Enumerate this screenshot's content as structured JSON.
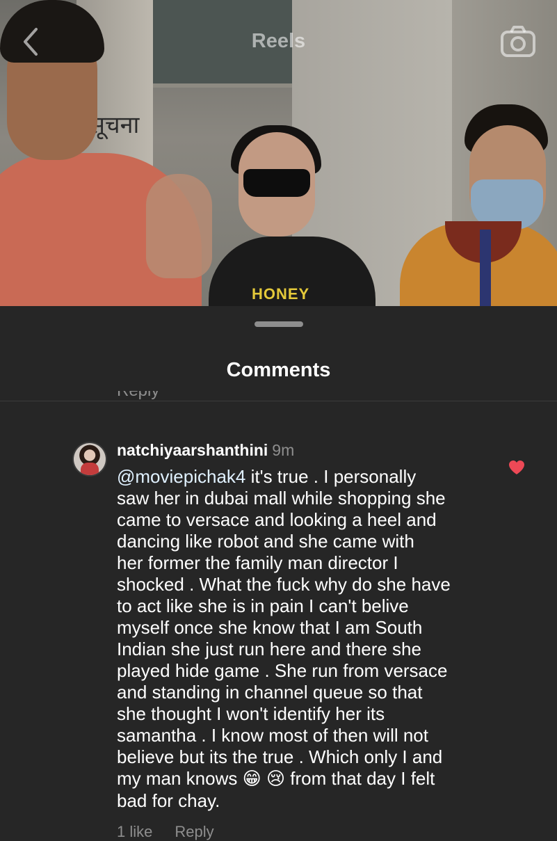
{
  "header": {
    "title": "Reels",
    "back_icon": "chevron-left-icon",
    "camera_icon": "camera-icon"
  },
  "video": {
    "sign_text": "सूचना",
    "shirt_text": "HONEY"
  },
  "sheet": {
    "title": "Comments",
    "cut_text": "Reply"
  },
  "comment": {
    "username": "natchiyaarshanthini",
    "time": "9m",
    "mention": "@moviepichak4",
    "text_before_emoji": " it's true . I personally\nsaw her in dubai mall while shopping  she\ncame to versace  and looking a heel and\ndancing like  robot  and she came with\nher former  the family man director I\nshocked . What the fuck why do she have\nto act like she is in pain I can't belive\nmyself once she know that I am South\nIndian she just run here and there she\nplayed hide game . She run from versace\nand standing in channel queue  so that\nshe thought  I won't identify her its\nsamantha . I know most of then will not\nbelieve  but its the true . Which only I and\nmy man knows ",
    "emoji_1": "😁",
    "emoji_2": "😢",
    "text_after_emoji": "  from that day I felt\nbad for chay.",
    "likes": "1 like",
    "reply": "Reply",
    "liked": true,
    "heart_color": "#ed4956"
  }
}
